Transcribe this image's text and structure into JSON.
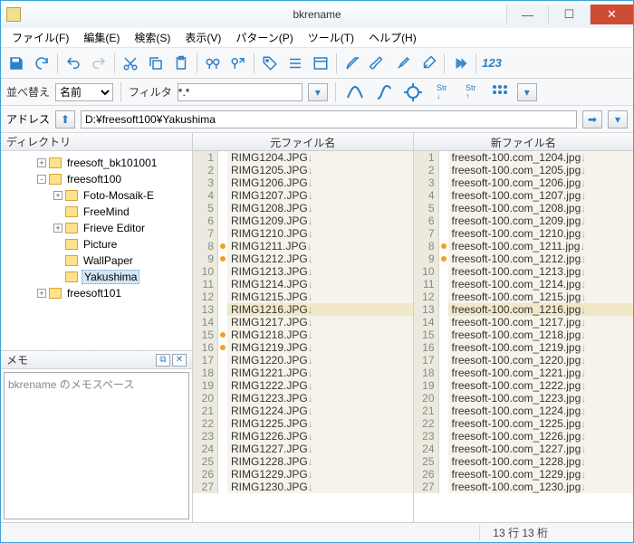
{
  "window": {
    "title": "bkrename"
  },
  "menu": {
    "file": "ファイル(F)",
    "edit": "編集(E)",
    "search": "検索(S)",
    "view": "表示(V)",
    "pattern": "パターン(P)",
    "tool": "ツール(T)",
    "help": "ヘルプ(H)"
  },
  "row2": {
    "sort_label": "並べ替え",
    "sort_value": "名前",
    "filter_label": "フィルタ",
    "filter_value": "*.*"
  },
  "address": {
    "label": "アドレス",
    "value": "D:¥freesoft100¥Yakushima"
  },
  "panes": {
    "dir": "ディレクトリ",
    "memo": "メモ",
    "orig": "元ファイル名",
    "new": "新ファイル名"
  },
  "memo": {
    "placeholder": "bkrename のメモスペース"
  },
  "tree": [
    {
      "indent": 0,
      "exp": "+",
      "label": "freesoft_bk101001"
    },
    {
      "indent": 0,
      "exp": "-",
      "label": "freesoft100"
    },
    {
      "indent": 1,
      "exp": "+",
      "label": "Foto-Mosaik-E"
    },
    {
      "indent": 1,
      "exp": "",
      "label": "FreeMind"
    },
    {
      "indent": 1,
      "exp": "+",
      "label": "Frieve Editor"
    },
    {
      "indent": 1,
      "exp": "",
      "label": "Picture"
    },
    {
      "indent": 1,
      "exp": "",
      "label": "WallPaper"
    },
    {
      "indent": 1,
      "exp": "",
      "label": "Yakushima",
      "sel": true
    },
    {
      "indent": 0,
      "exp": "+",
      "label": "freesoft101"
    }
  ],
  "files": {
    "orig_prefix": "RIMG",
    "orig_suffix": ".JPG",
    "new_prefix": "freesoft-100.com_",
    "new_suffix": ".jpg",
    "start": 1204,
    "count": 27,
    "marks_orig": [
      8,
      9,
      15,
      16
    ],
    "marks_new": [
      8,
      9
    ],
    "highlight_row": 13
  },
  "status": {
    "pos": "13 行 13 桁"
  }
}
